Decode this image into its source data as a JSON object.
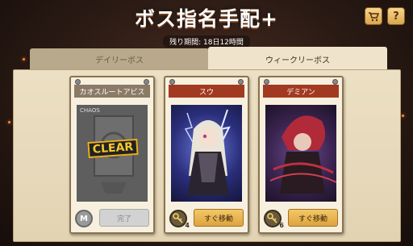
{
  "header": {
    "title": "ボス指名手配+",
    "remaining_time": "残り期間: 18日12時間",
    "shop_icon": "cart-icon",
    "help_label": "?"
  },
  "tabs": [
    {
      "label": "デイリーボス",
      "active": false
    },
    {
      "label": "ウィークリーボス",
      "active": true
    }
  ],
  "cards": [
    {
      "boss_name": "カオスルートアビス",
      "image_caption": "CHAOS",
      "badge": "CLEAR",
      "reward_icon": "m-coin-icon",
      "reward_label": "M",
      "button_label": "完了",
      "state": "cleared"
    },
    {
      "boss_name": "スウ",
      "reward_icon": "key-icon",
      "reward_count": "4",
      "button_label": "すぐ移動",
      "state": "available"
    },
    {
      "boss_name": "デミアン",
      "reward_icon": "key-icon",
      "reward_count": "6",
      "button_label": "すぐ移動",
      "state": "available"
    }
  ],
  "colors": {
    "header_red": "#a23a22",
    "button_gold": "#e8b650",
    "board_parchment": "#e6d8b8"
  }
}
